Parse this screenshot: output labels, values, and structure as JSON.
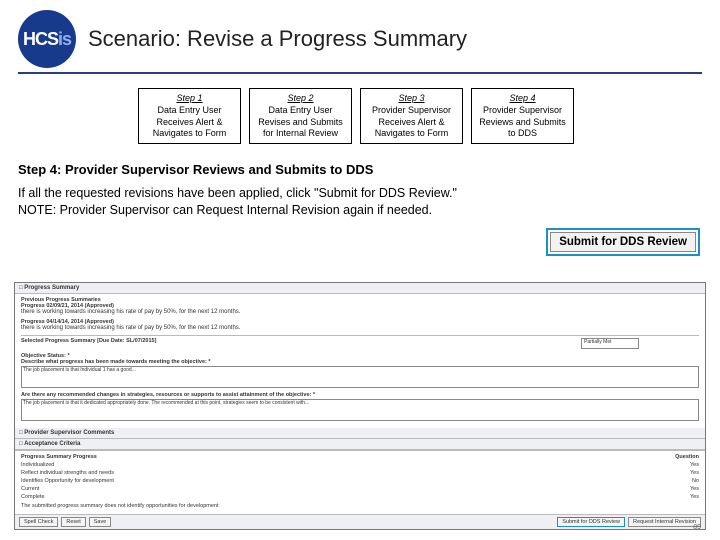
{
  "header": {
    "logo_text_hc": "HC",
    "logo_text_s": "S",
    "logo_text_is": "is",
    "title": "Scenario: Revise a Progress Summary"
  },
  "steps": [
    {
      "hd": "Step 1",
      "body": "Data Entry User Receives Alert & Navigates to Form"
    },
    {
      "hd": "Step 2",
      "body": "Data Entry User Revises and Submits for Internal Review"
    },
    {
      "hd": "Step 3",
      "body": "Provider Supervisor Receives Alert & Navigates to Form"
    },
    {
      "hd": "Step 4",
      "body": "Provider Supervisor Reviews and Submits to DDS"
    }
  ],
  "section_heading": "Step 4: Provider Supervisor Reviews and Submits to DDS",
  "body_line1": "If all the requested revisions have been applied, click \"Submit for DDS Review.\"",
  "body_line2": "NOTE: Provider Supervisor can Request Internal Revision again if needed.",
  "submit_button": "Submit for DDS Review",
  "form": {
    "bar1": "□ Progress Summary",
    "prev_hdr": "Previous Progress Summaries",
    "prev1_lbl": "Progress 02/09/21, 2014 (Approved)",
    "prev1_txt": "there is working towards increasing his rate of pay by 50%, for the next 12 months.",
    "prev2_lbl": "Progress 04/14/14, 2014 (Approved)",
    "prev2_txt": "there is working towards increasing his rate of pay by 50%, for the next 12 months.",
    "sel_hdr": "Selected Progress Summary [Due Date: SL/07/2015]",
    "sel_opt": "Partially Met",
    "q_status": "Objective Status: *",
    "q_desc": "Describe what progress has been made towards meeting the objective: *",
    "q_desc_val": "The job placement is that Individual 1 has a good...",
    "q_changes": "Are there any recommended changes in strategies, resources or supports to assist attainment of the objective: *",
    "q_changes_val": "The job placement is that it dedicated appropriately done. The recommended at this point, strategies seem to be consistent with...",
    "bar2": "□ Provider Supervisor Comments",
    "bar3": "□ Acceptance Criteria",
    "crit_hdr_l": "Progress Summary Progress",
    "crit_hdr_r": "Question",
    "crit": [
      {
        "l": "Individualized",
        "r": "Yes"
      },
      {
        "l": "Reflect individual strengths and needs",
        "r": "Yes"
      },
      {
        "l": "Identifies Opportunity for development",
        "r": "No"
      },
      {
        "l": "Current",
        "r": "Yes"
      },
      {
        "l": "Complete",
        "r": "Yes"
      }
    ],
    "crit_note": "The submitted progress summary does not identify opportunities for development",
    "btn_spell": "Spell Check",
    "btn_reset": "Reset",
    "btn_save": "Save",
    "btn_submit": "Submit for DDS Review",
    "btn_request": "Request Internal Revision",
    "pagenum": "89"
  }
}
